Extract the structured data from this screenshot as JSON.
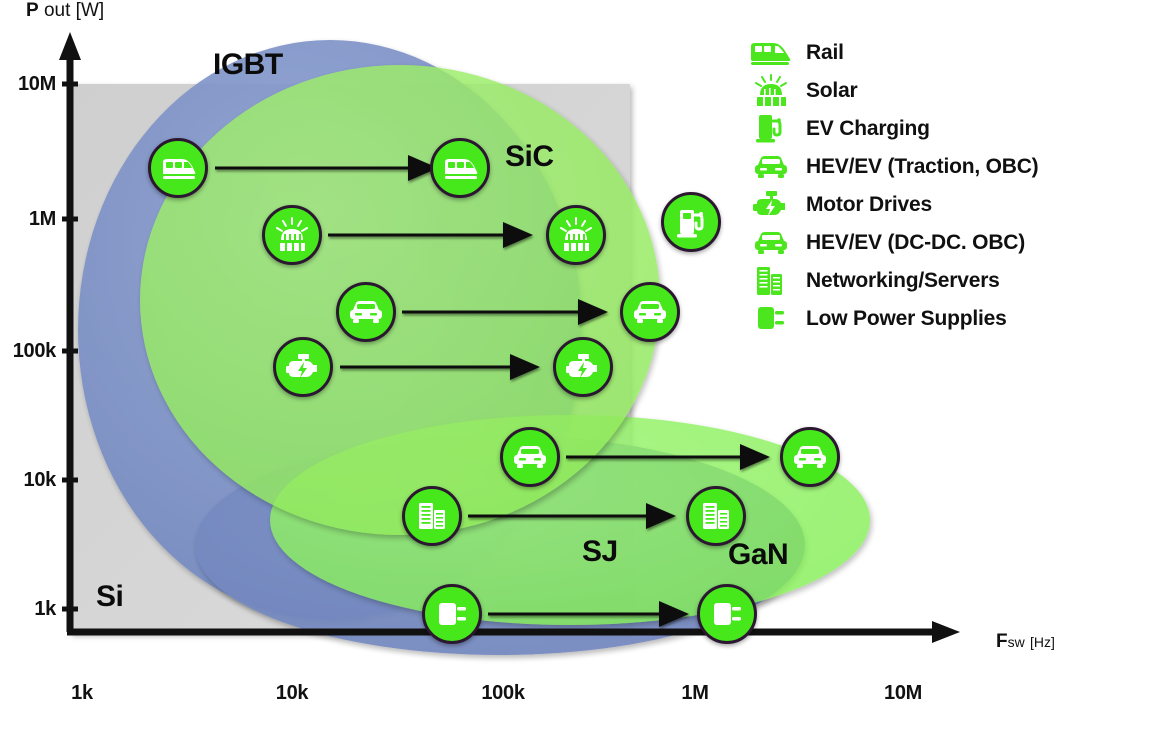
{
  "chart_data": {
    "type": "scatter",
    "title": "",
    "xlabel": "Fsw [Hz]",
    "ylabel": "P out [W]",
    "xlabel_main": "F",
    "xlabel_sub": "sw",
    "xlabel_unit": "[Hz]",
    "ylabel_main": "P",
    "ylabel_rest": "out [W]",
    "x_ticks": [
      "1k",
      "10k",
      "100k",
      "1M",
      "10M"
    ],
    "y_ticks": [
      "10M",
      "1M",
      "100k",
      "10k",
      "1k"
    ],
    "xlim": [
      "1k",
      "30M"
    ],
    "ylim": [
      "700",
      "20M"
    ],
    "grid": false,
    "legend_position": "top-right",
    "axis_scale": "log-log",
    "regions": [
      {
        "name": "Si",
        "label": "Si",
        "color": "#d4d4d4",
        "shape": "rect"
      },
      {
        "name": "IGBT",
        "label": "IGBT",
        "color": "#8194c9",
        "shape": "ellipse"
      },
      {
        "name": "SiC",
        "label": "SiC",
        "color": "#9df069",
        "shape": "ellipse"
      },
      {
        "name": "SJ",
        "label": "SJ",
        "color": "#4fa394",
        "shape": "ellipse"
      },
      {
        "name": "GaN",
        "label": "GaN",
        "color": "#8bef5e",
        "shape": "ellipse"
      }
    ],
    "transitions": [
      {
        "application": "Rail",
        "icon": "rail-icon",
        "from": {
          "fsw": "3k",
          "p": "3M"
        },
        "to": {
          "fsw": "40k",
          "p": "3M"
        }
      },
      {
        "application": "Solar",
        "icon": "solar-icon",
        "from": {
          "fsw": "8k",
          "p": "1M"
        },
        "to": {
          "fsw": "140k",
          "p": "1M"
        }
      },
      {
        "application": "HEV/EV (Traction, OBC)",
        "icon": "car-icon",
        "from": {
          "fsw": "18k",
          "p": "300k"
        },
        "to": {
          "fsw": "280k",
          "p": "300k"
        }
      },
      {
        "application": "Motor Drives",
        "icon": "motor-icon",
        "from": {
          "fsw": "10k",
          "p": "90k"
        },
        "to": {
          "fsw": "170k",
          "p": "90k"
        }
      },
      {
        "application": "HEV/EV (DC-DC. OBC)",
        "icon": "car-icon",
        "from": {
          "fsw": "130k",
          "p": "14k"
        },
        "to": {
          "fsw": "2.4M",
          "p": "14k"
        }
      },
      {
        "application": "Networking/Servers",
        "icon": "server-icon",
        "from": {
          "fsw": "70k",
          "p": "7k"
        },
        "to": {
          "fsw": "1.1M",
          "p": "7k"
        }
      },
      {
        "application": "Low Power Supplies",
        "icon": "lowpower-icon",
        "from": {
          "fsw": "85k",
          "p": "1.1k"
        },
        "to": {
          "fsw": "1.2M",
          "p": "1.1k"
        }
      }
    ],
    "standalone_points": [
      {
        "application": "EV Charging",
        "icon": "evcharge-icon",
        "fsw": "1M",
        "p": "1M"
      }
    ]
  },
  "legend": {
    "items": [
      {
        "label": "Rail",
        "icon": "rail-icon"
      },
      {
        "label": "Solar",
        "icon": "solar-icon"
      },
      {
        "label": "EV Charging",
        "icon": "evcharge-icon"
      },
      {
        "label": "HEV/EV (Traction, OBC)",
        "icon": "car-icon"
      },
      {
        "label": "Motor Drives",
        "icon": "motor-icon"
      },
      {
        "label": "HEV/EV (DC-DC. OBC)",
        "icon": "car-icon"
      },
      {
        "label": "Networking/Servers",
        "icon": "server-icon"
      },
      {
        "label": "Low Power Supplies",
        "icon": "lowpower-icon"
      }
    ]
  },
  "colors": {
    "marker_green": "#46e81b",
    "marker_stroke": "#2b1830",
    "legend_green": "#4ce61f",
    "si_gray": "#d4d4d4",
    "igbt_blue": "#8194c9",
    "sic_green": "#9df069",
    "gan_green": "#8bef5e",
    "sj_teal": "#4fa394",
    "axis_black": "#111111"
  }
}
